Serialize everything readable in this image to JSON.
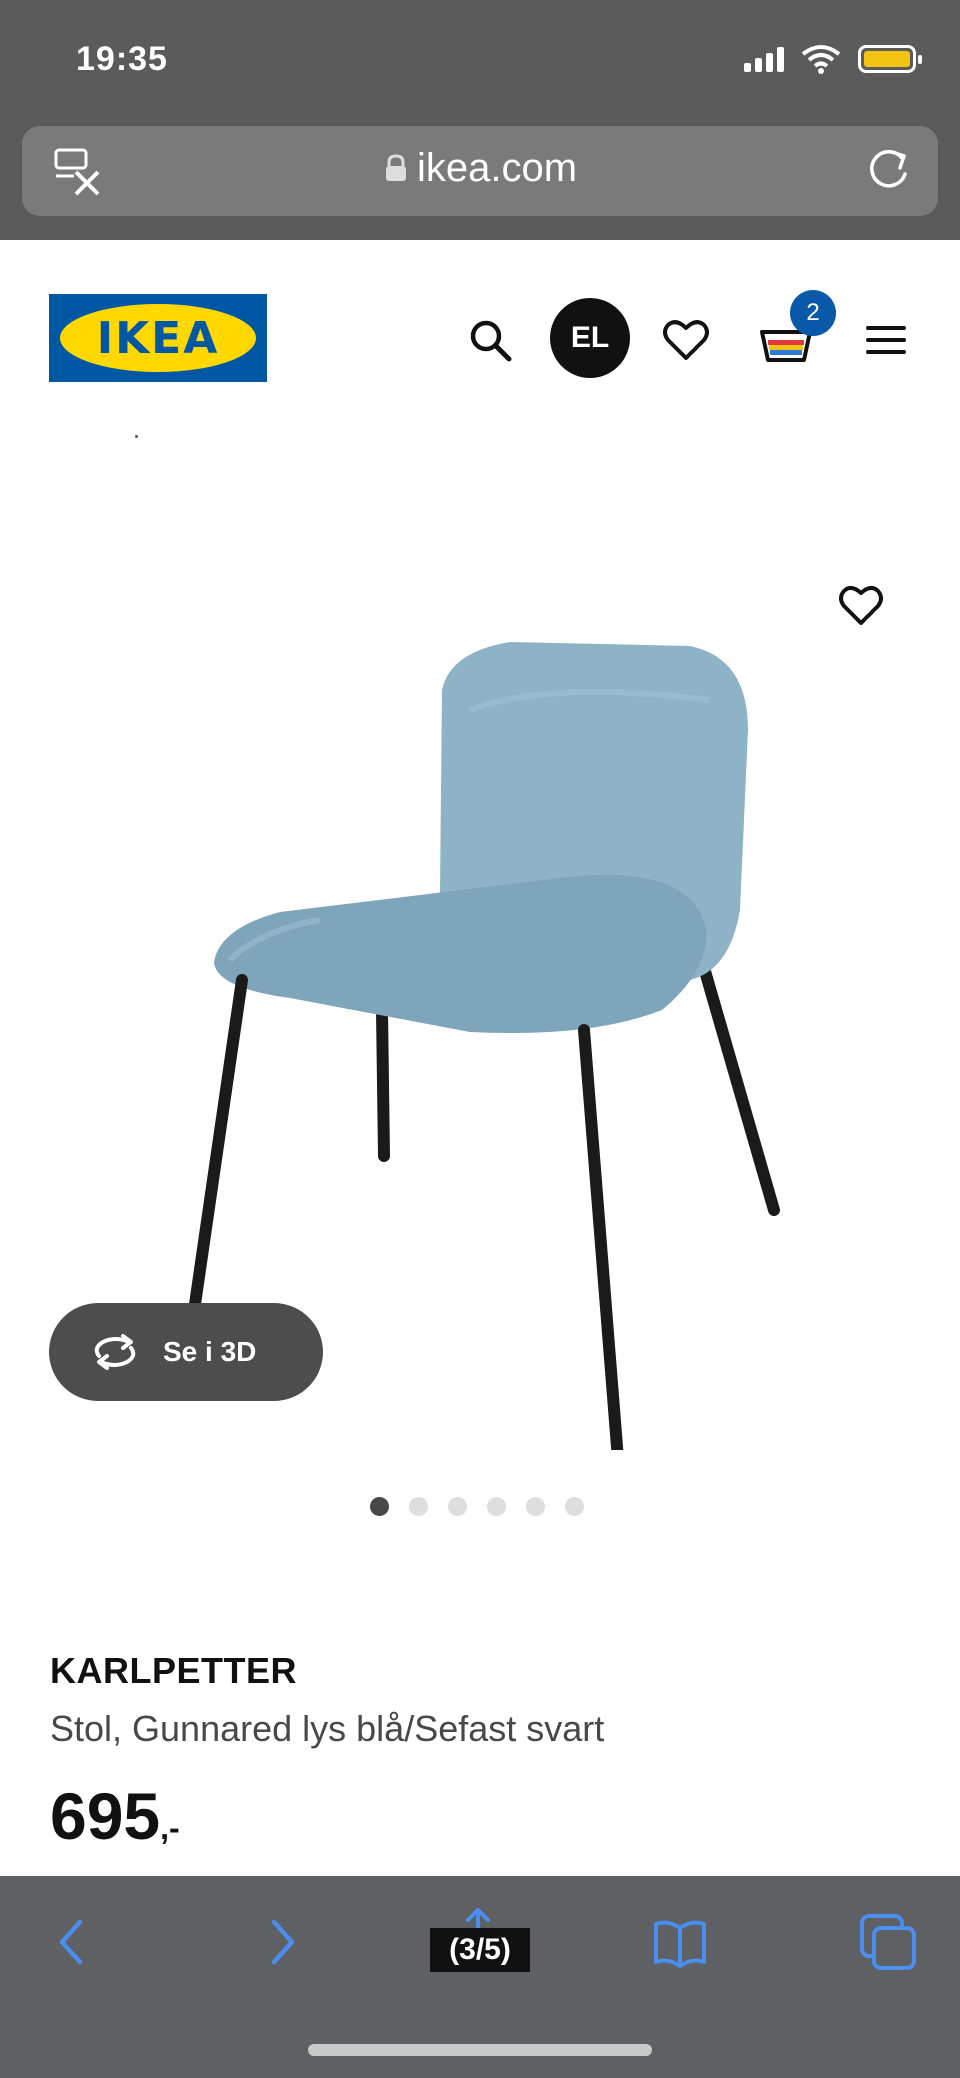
{
  "status_bar": {
    "time": "19:35",
    "battery_color": "#f2c40f"
  },
  "url_bar": {
    "domain": "ikea.com",
    "lock_icon": "lock-icon",
    "reload_icon": "reload-icon",
    "left_icon": "tab-close-icon"
  },
  "header": {
    "logo_text": "IKEA",
    "avatar_initials": "EL",
    "cart_count": "2",
    "icons": [
      "search-icon",
      "heart-icon",
      "cart-icon",
      "menu-icon"
    ]
  },
  "gallery": {
    "view_3d_label": "Se i 3D",
    "image_count": 6,
    "active_index": 0
  },
  "product": {
    "name": "KARLPETTER",
    "description": "Stol, Gunnared lys blå/Sefast svart",
    "price": "695",
    "price_suffix": ",-"
  },
  "toolbar": {
    "counter": "(3/5)"
  },
  "colors": {
    "ikea_blue": "#0057a3",
    "ikea_yellow": "#ffd800",
    "chair_fabric": "#8fb3c6",
    "badge_blue": "#0a59a8"
  }
}
